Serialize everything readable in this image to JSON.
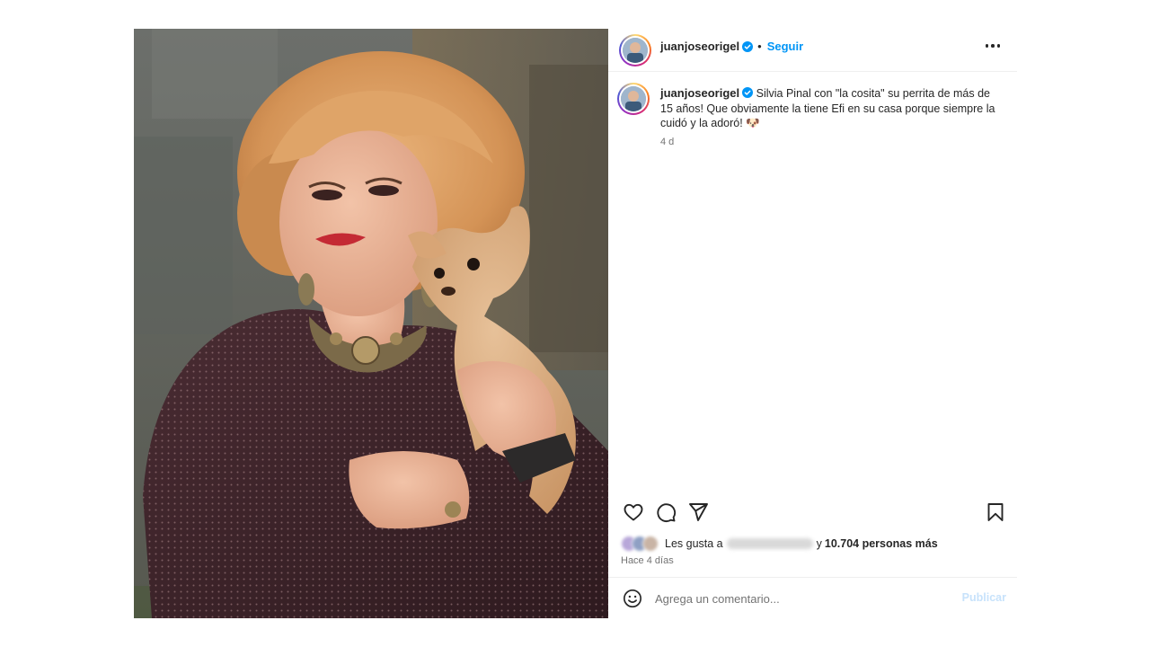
{
  "post": {
    "username": "juanjoseorigel",
    "verified": true,
    "follow_label": "Seguir",
    "separator": "•",
    "more_label": "Más opciones",
    "caption": {
      "username": "juanjoseorigel",
      "text": "Silvia Pinal con \"la cosita\" su perrita de más de 15 años! Que obviamente la tiene Efi en su casa porque siempre la cuidó y la adoró! 🐶",
      "time": "4 d"
    },
    "likes": {
      "prefix": "Les gusta a",
      "connector": "y",
      "count": "10.704 personas más"
    },
    "posted": "Hace 4 días",
    "comment": {
      "placeholder": "Agrega un comentario...",
      "publish_label": "Publicar"
    }
  },
  "colors": {
    "accent": "#0095f6",
    "publish_disabled": "#c7e2fb",
    "secondary_text": "#737373",
    "text": "#262626",
    "divider": "#efefef"
  },
  "icons": [
    "heart-icon",
    "comment-icon",
    "share-icon",
    "bookmark-icon",
    "emoji-icon",
    "verified-badge-icon",
    "more-options-icon"
  ]
}
